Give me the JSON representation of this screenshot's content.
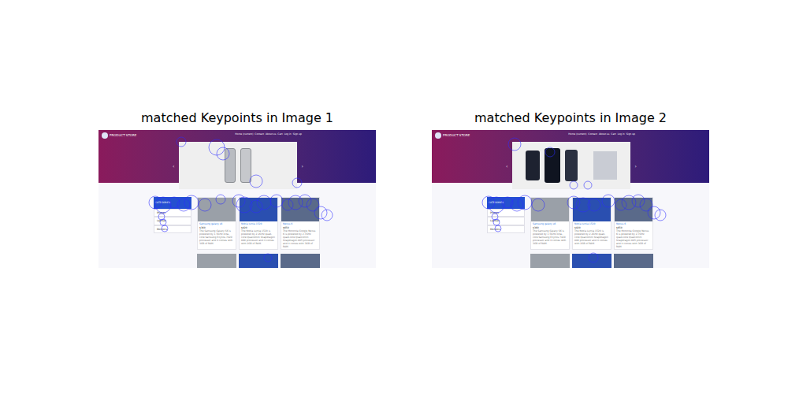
{
  "figure": {
    "panels": [
      {
        "title": "matched Keypoints in Image 1",
        "carousel": {
          "kind": "silver"
        }
      },
      {
        "title": "matched Keypoints in Image 2",
        "carousel": {
          "kind": "dark"
        }
      }
    ]
  },
  "page": {
    "brand": "PRODUCT STORE",
    "nav": [
      "Home (current)",
      "Contact",
      "About us",
      "Cart",
      "Log in",
      "Sign up"
    ],
    "carousel_prev": "‹",
    "carousel_next": "›",
    "categories": {
      "header": "CATEGORIES",
      "items": [
        "Phones",
        "Laptops",
        "Monitors"
      ]
    },
    "products": [
      {
        "name": "Samsung galaxy s6",
        "price": "$360",
        "desc": "The Samsung Galaxy S6 is powered by 1.5GHz octa-core Samsung Exynos 7420 processor and it comes with 3GB of RAM."
      },
      {
        "name": "Nokia lumia 1520",
        "price": "$820",
        "desc": "The Nokia Lumia 1520 is powered by 2.2GHz quad-core Qualcomm Snapdragon 800 processor and it comes with 2GB of RAM."
      },
      {
        "name": "Nexus 6",
        "price": "$650",
        "desc": "The Motorola Google Nexus 6 is powered by 2.7GHz quad-core Qualcomm Snapdragon 805 processor and it comes with 3GB of RAM."
      }
    ]
  }
}
